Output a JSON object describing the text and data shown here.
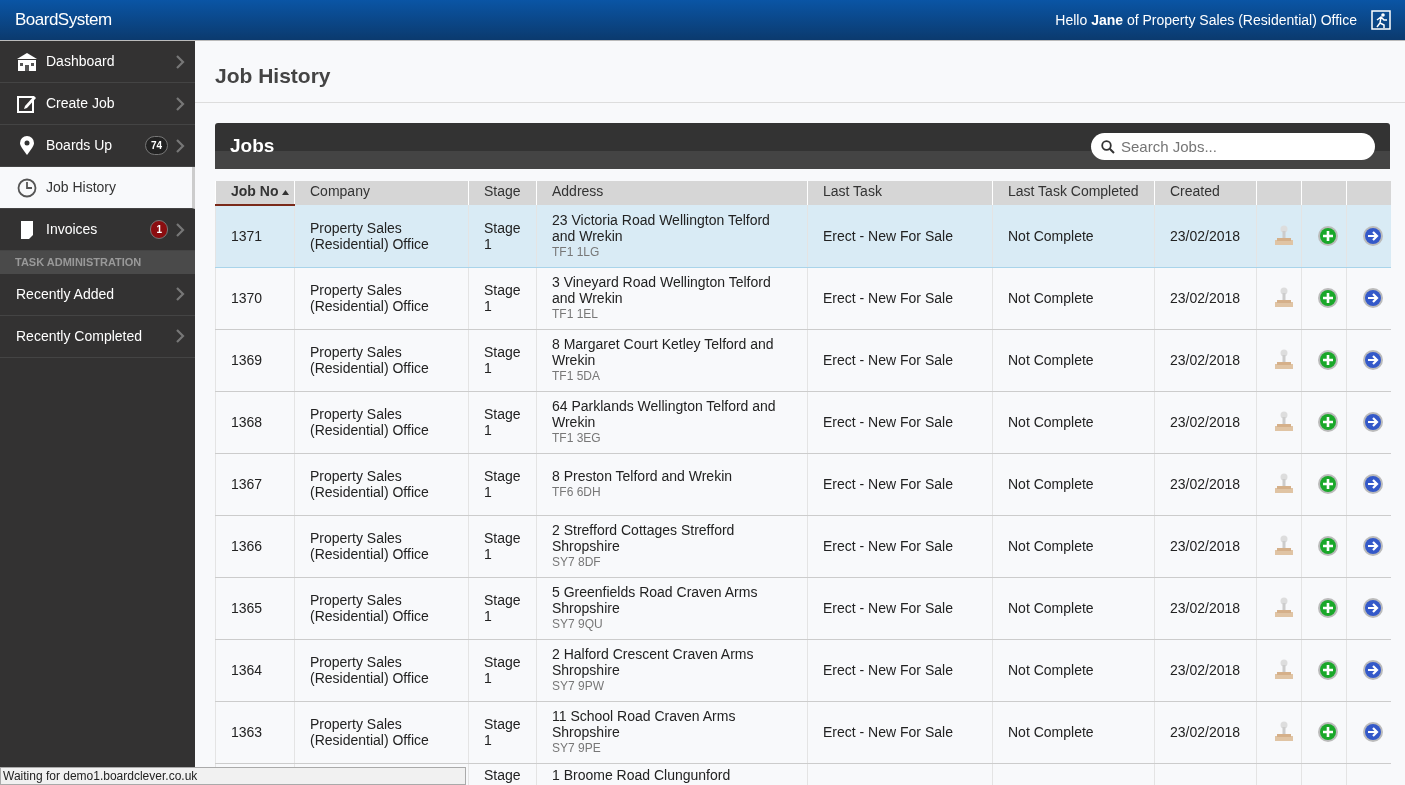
{
  "app": {
    "logo": "BoardSystem",
    "greeting": "Hello **Jane** of Property Sales (Residential) Office"
  },
  "sidebar": {
    "items": [
      {
        "label": "Dashboard",
        "selected": false
      },
      {
        "label": "Create Job",
        "selected": false
      },
      {
        "label": "Boards Up",
        "badge": "74",
        "color": "#222222",
        "selected": false
      },
      {
        "label": "Job History",
        "selected": true
      },
      {
        "label": "Invoices",
        "badge": "1",
        "color": "#8b0d10",
        "selected": false
      }
    ],
    "section": "TASK ADMINISTRATION",
    "section_items": [
      {
        "label": "Recently Added",
        "selected": false
      },
      {
        "label": "Recently Completed",
        "selected": false
      }
    ]
  },
  "page": {
    "title": "Job History"
  },
  "panel": {
    "title": "Jobs",
    "search": {
      "placeholder": "Search Jobs..."
    }
  },
  "table": {
    "columns": [
      {
        "label": "Job No",
        "sorted": true
      },
      {
        "label": "Company",
        "sorted": false
      },
      {
        "label": "Stage",
        "sorted": false
      },
      {
        "label": "Address",
        "sorted": false
      },
      {
        "label": "Last Task",
        "sorted": false
      },
      {
        "label": "Last Task Completed",
        "sorted": false
      },
      {
        "label": "Created",
        "sorted": false
      }
    ],
    "rows": [
      {
        "kind": "full",
        "selected": true,
        "job_no": "1371",
        "company": "Property Sales (Residential) Office",
        "stage": "Stage 1",
        "address": "23 Victoria Road Wellington Telford and Wrekin",
        "postcode": "TF1 1LG",
        "last_task": "Erect - New For Sale",
        "completed": "Not Complete",
        "created": "23/02/2018"
      },
      {
        "kind": "full",
        "selected": false,
        "job_no": "1370",
        "company": "Property Sales (Residential) Office",
        "stage": "Stage 1",
        "address": "3 Vineyard Road Wellington Telford and Wrekin",
        "postcode": "TF1 1EL",
        "last_task": "Erect - New For Sale",
        "completed": "Not Complete",
        "created": "23/02/2018"
      },
      {
        "kind": "full",
        "selected": false,
        "job_no": "1369",
        "company": "Property Sales (Residential) Office",
        "stage": "Stage 1",
        "address": "8 Margaret Court Ketley Telford and Wrekin",
        "postcode": "TF1 5DA",
        "last_task": "Erect - New For Sale",
        "completed": "Not Complete",
        "created": "23/02/2018"
      },
      {
        "kind": "full",
        "selected": false,
        "job_no": "1368",
        "company": "Property Sales (Residential) Office",
        "stage": "Stage 1",
        "address": "64 Parklands Wellington Telford and Wrekin",
        "postcode": "TF1 3EG",
        "last_task": "Erect - New For Sale",
        "completed": "Not Complete",
        "created": "23/02/2018"
      },
      {
        "kind": "full",
        "selected": false,
        "job_no": "1367",
        "company": "Property Sales (Residential) Office",
        "stage": "Stage 1",
        "address": "8 Preston Telford and Wrekin",
        "postcode": "TF6 6DH",
        "last_task": "Erect - New For Sale",
        "completed": "Not Complete",
        "created": "23/02/2018"
      },
      {
        "kind": "full",
        "selected": false,
        "job_no": "1366",
        "company": "Property Sales (Residential) Office",
        "stage": "Stage 1",
        "address": "2 Strefford Cottages Strefford Shropshire",
        "postcode": "SY7 8DF",
        "last_task": "Erect - New For Sale",
        "completed": "Not Complete",
        "created": "23/02/2018"
      },
      {
        "kind": "full",
        "selected": false,
        "job_no": "1365",
        "company": "Property Sales (Residential) Office",
        "stage": "Stage 1",
        "address": "5 Greenfields Road Craven Arms Shropshire",
        "postcode": "SY7 9QU",
        "last_task": "Erect - New For Sale",
        "completed": "Not Complete",
        "created": "23/02/2018"
      },
      {
        "kind": "full",
        "selected": false,
        "job_no": "1364",
        "company": "Property Sales (Residential) Office",
        "stage": "Stage 1",
        "address": "2 Halford Crescent Craven Arms Shropshire",
        "postcode": "SY7 9PW",
        "last_task": "Erect - New For Sale",
        "completed": "Not Complete",
        "created": "23/02/2018"
      },
      {
        "kind": "full",
        "selected": false,
        "job_no": "1363",
        "company": "Property Sales (Residential) Office",
        "stage": "Stage 1",
        "address": "11 School Road Craven Arms Shropshire",
        "postcode": "SY7 9PE",
        "last_task": "Erect - New For Sale",
        "completed": "Not Complete",
        "created": "23/02/2018"
      },
      {
        "kind": "partial",
        "selected": false,
        "stage": "Stage",
        "address": "1 Broome Road Clungunford"
      }
    ]
  },
  "status_bar": "Waiting for demo1.boardclever.co.uk"
}
